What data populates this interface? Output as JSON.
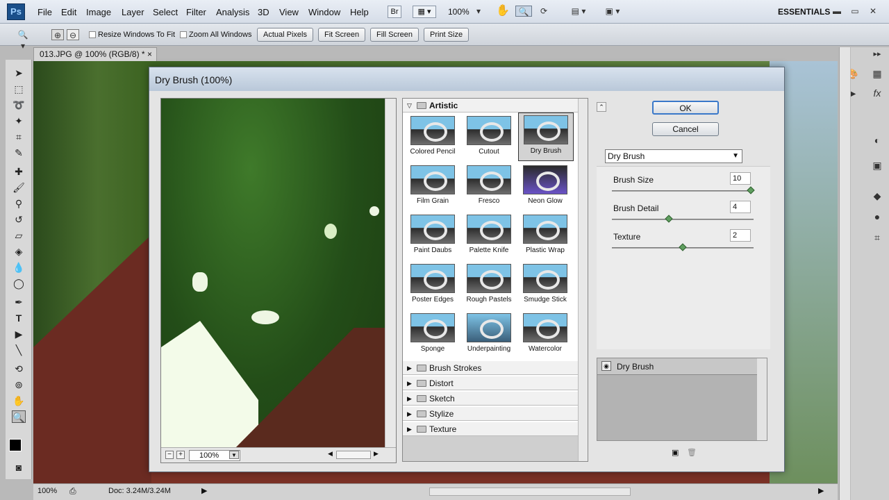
{
  "menubar": {
    "logo": "Ps",
    "items": [
      "File",
      "Edit",
      "Image",
      "Layer",
      "Select",
      "Filter",
      "Analysis",
      "3D",
      "View",
      "Window",
      "Help"
    ],
    "bridge": "Br",
    "zoom": "100%",
    "workspace": "ESSENTIALS"
  },
  "options": {
    "resize_windows": "Resize Windows To Fit",
    "zoom_all": "Zoom All Windows",
    "buttons": [
      "Actual Pixels",
      "Fit Screen",
      "Fill Screen",
      "Print Size"
    ]
  },
  "document": {
    "tab": "013.JPG @ 100% (RGB/8) *",
    "close": "×",
    "status_zoom": "100%",
    "status_doc": "Doc: 3.24M/3.24M"
  },
  "dialog": {
    "title": "Dry Brush (100%)",
    "preview_zoom": "100%",
    "category_open": "Artistic",
    "thumbnails": [
      "Colored Pencil",
      "Cutout",
      "Dry Brush",
      "Film Grain",
      "Fresco",
      "Neon Glow",
      "Paint Daubs",
      "Palette Knife",
      "Plastic Wrap",
      "Poster Edges",
      "Rough Pastels",
      "Smudge Stick",
      "Sponge",
      "Underpainting",
      "Watercolor"
    ],
    "selected_thumbnail": "Dry Brush",
    "categories_closed": [
      "Brush Strokes",
      "Distort",
      "Sketch",
      "Stylize",
      "Texture"
    ],
    "ok": "OK",
    "cancel": "Cancel",
    "filter_select": "Dry Brush",
    "params": [
      {
        "label": "Brush Size",
        "value": "10",
        "fraction": 1.0
      },
      {
        "label": "Brush Detail",
        "value": "4",
        "fraction": 0.4
      },
      {
        "label": "Texture",
        "value": "2",
        "fraction": 0.5
      }
    ],
    "layer": "Dry Brush"
  }
}
